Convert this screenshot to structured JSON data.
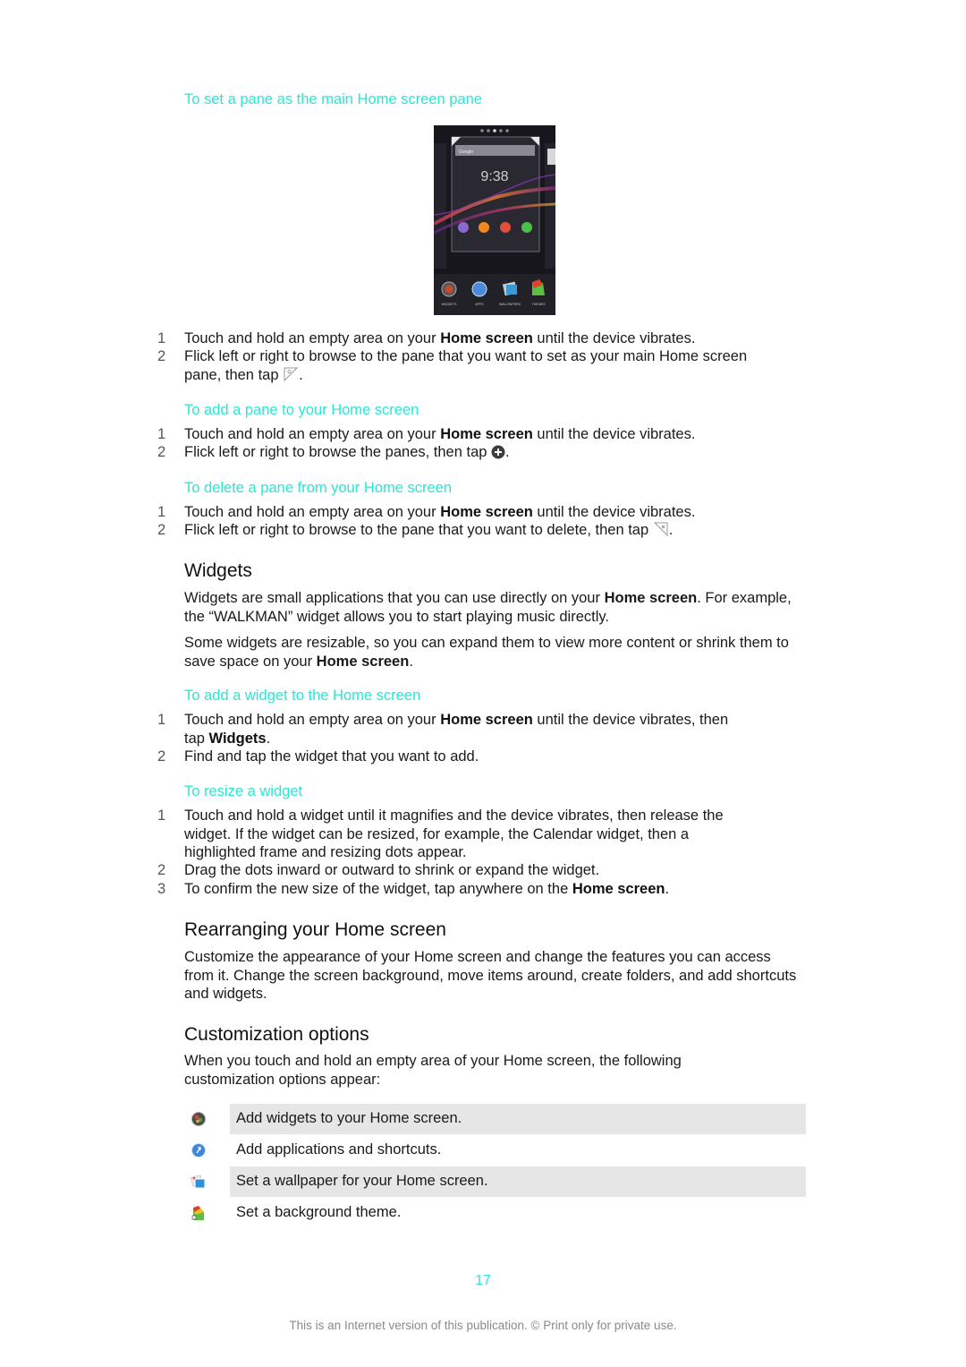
{
  "sections": {
    "set_main_pane": {
      "title": "To set a pane as the main Home screen pane",
      "steps": [
        {
          "num": "1",
          "pre": "Touch and hold an empty area on your ",
          "bold": "Home screen",
          "post": " until the device vibrates."
        },
        {
          "num": "2",
          "pre": "Flick left or right to browse to the pane that you want to set as your main Home screen pane, then tap ",
          "icon": "set-main-pane-icon",
          "post": "."
        }
      ]
    },
    "add_pane": {
      "title": "To add a pane to your Home screen",
      "steps": [
        {
          "num": "1",
          "pre": "Touch and hold an empty area on your ",
          "bold": "Home screen",
          "post": " until the device vibrates."
        },
        {
          "num": "2",
          "pre": "Flick left or right to browse the panes, then tap ",
          "icon": "add-pane-icon",
          "post": "."
        }
      ]
    },
    "delete_pane": {
      "title": "To delete a pane from your Home screen",
      "steps": [
        {
          "num": "1",
          "pre": "Touch and hold an empty area on your ",
          "bold": "Home screen",
          "post": " until the device vibrates."
        },
        {
          "num": "2",
          "pre": "Flick left or right to browse to the pane that you want to delete, then tap ",
          "icon": "delete-pane-icon",
          "post": "."
        }
      ]
    },
    "widgets": {
      "heading": "Widgets",
      "para1_pre": "Widgets are small applications that you can use directly on your ",
      "para1_bold": "Home screen",
      "para1_post": ". For example, the “WALKMAN” widget allows you to start playing music directly.",
      "para2_pre": "Some widgets are resizable, so you can expand them to view more content or shrink them to save space on your ",
      "para2_bold": "Home screen",
      "para2_post": "."
    },
    "add_widget": {
      "title": "To add a widget to the Home screen",
      "steps": [
        {
          "num": "1",
          "pre": "Touch and hold an empty area on your ",
          "bold": "Home screen",
          "mid": " until the device vibrates, then tap ",
          "bold2": "Widgets",
          "post": "."
        },
        {
          "num": "2",
          "pre": "Find and tap the widget that you want to add."
        }
      ]
    },
    "resize_widget": {
      "title": "To resize a widget",
      "steps": [
        {
          "num": "1",
          "pre": "Touch and hold a widget until it magnifies and the device vibrates, then release the widget. If the widget can be resized, for example, the Calendar widget, then a highlighted frame and resizing dots appear."
        },
        {
          "num": "2",
          "pre": "Drag the dots inward or outward to shrink or expand the widget."
        },
        {
          "num": "3",
          "pre": "To confirm the new size of the widget, tap anywhere on the ",
          "bold": "Home screen",
          "post": "."
        }
      ]
    },
    "rearranging": {
      "heading": "Rearranging your Home screen",
      "para": "Customize the appearance of your Home screen and change the features you can access from it. Change the screen background, move items around, create folders, and add shortcuts and widgets."
    },
    "customization": {
      "heading": "Customization options",
      "para": "When you touch and hold an empty area of your Home screen, the following customization options appear:",
      "options": [
        {
          "icon": "widgets-icon",
          "label": "Add widgets to your Home screen.",
          "shaded": true
        },
        {
          "icon": "apps-icon",
          "label": "Add applications and shortcuts.",
          "shaded": false
        },
        {
          "icon": "wallpapers-icon",
          "label": "Set a wallpaper for your Home screen.",
          "shaded": true
        },
        {
          "icon": "themes-icon",
          "label": "Set a background theme.",
          "shaded": false
        }
      ]
    }
  },
  "phone_screenshot": {
    "search_label": "Google",
    "clock": "9:38",
    "dock_labels": [
      "WIDGETS",
      "APPS",
      "WALLPAPERS",
      "THEMES"
    ]
  },
  "page_number": "17",
  "footer": "This is an Internet version of this publication. © Print only for private use.",
  "colors": {
    "accent": "#27e8d6",
    "text": "#1a1a1a",
    "shade": "#e6e6e6",
    "footer": "#8a8a8a"
  }
}
